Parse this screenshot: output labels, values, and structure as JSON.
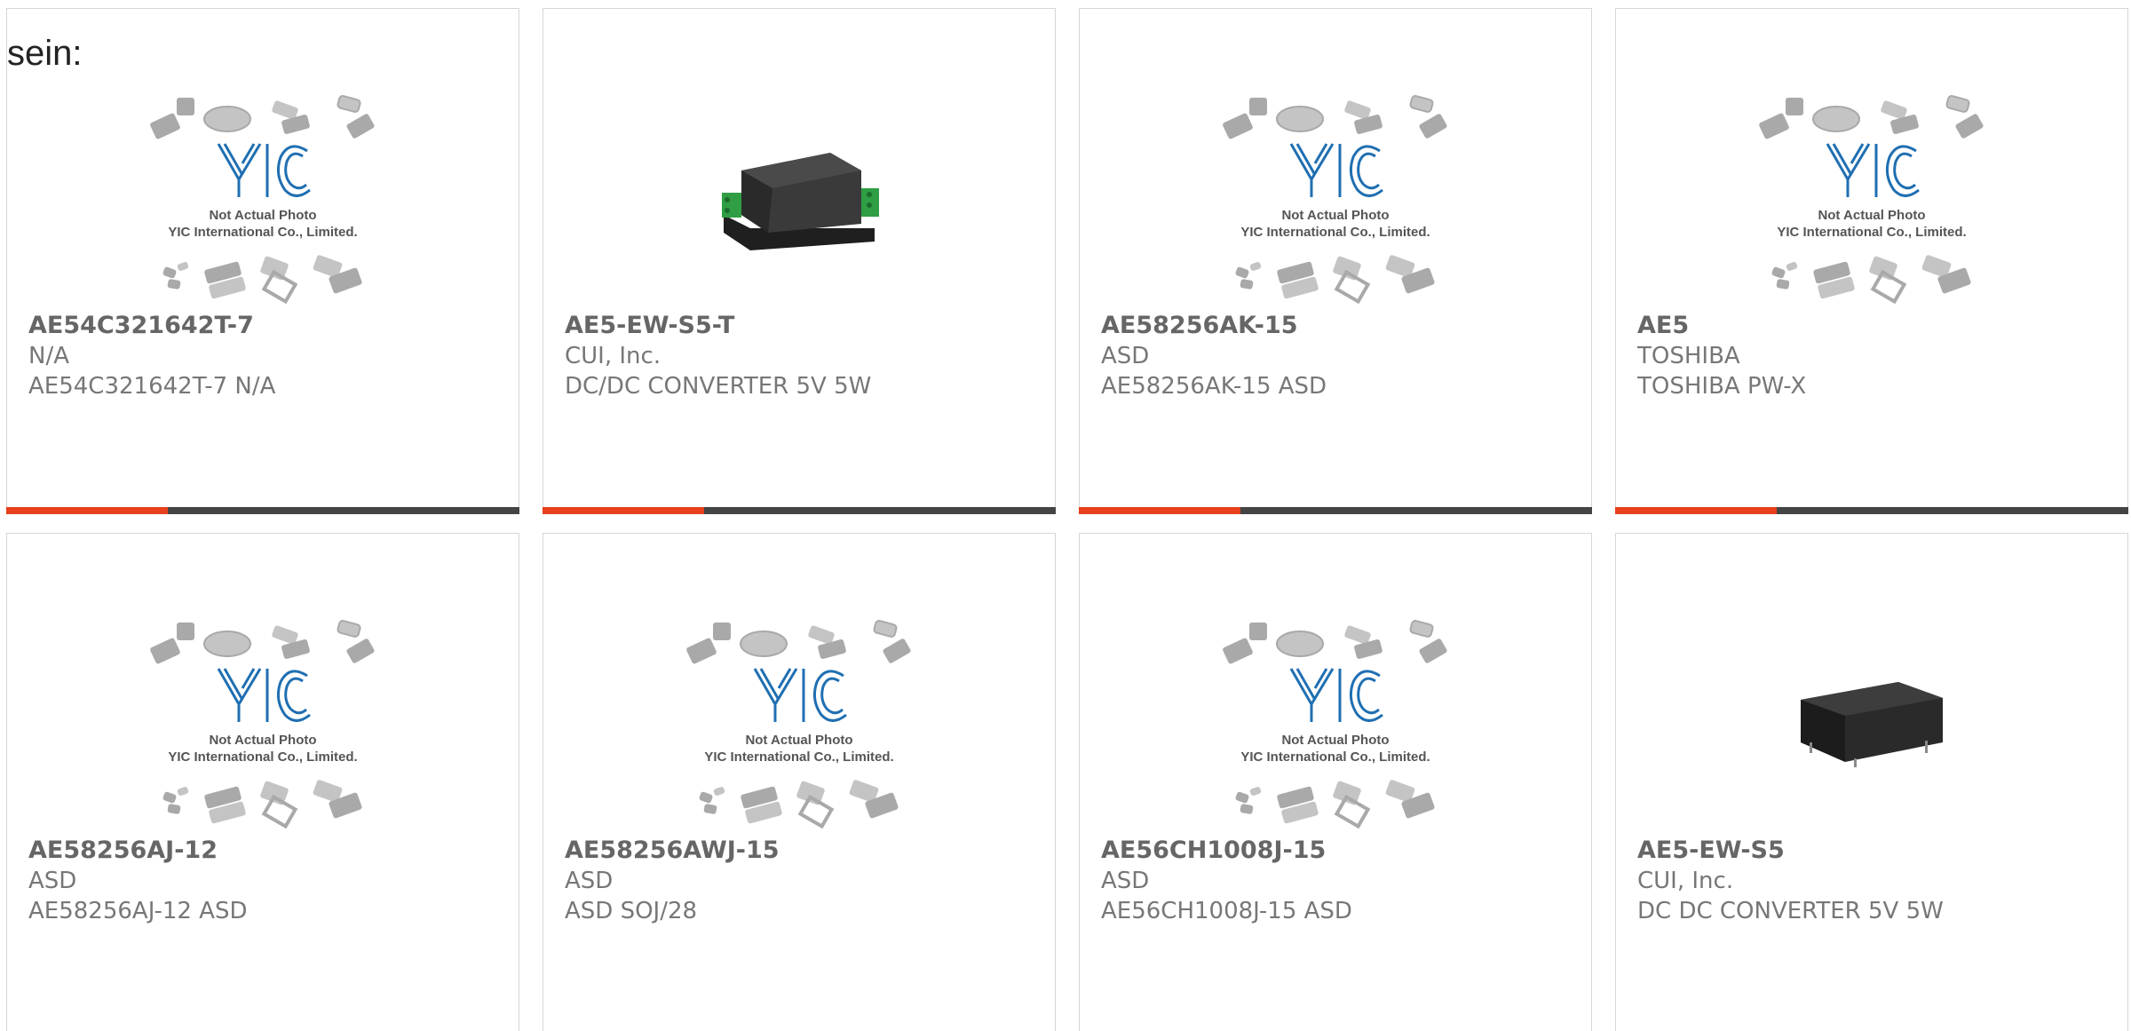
{
  "lead_text": "sein:",
  "colors": {
    "accent": "#e8401c",
    "bar_dark": "#444444",
    "logo_blue": "#1f6fb2"
  },
  "placeholder": {
    "line1": "Not Actual Photo",
    "line2": "YIC International Co., Limited."
  },
  "products": [
    {
      "part": "AE54C321642T-7",
      "manufacturer": "N/A",
      "description": "AE54C321642T-7 N/A",
      "image": "placeholder"
    },
    {
      "part": "AE5-EW-S5-T",
      "manufacturer": "CUI, Inc.",
      "description": "DC/DC CONVERTER 5V 5W",
      "image": "converter-with-terminals"
    },
    {
      "part": "AE58256AK-15",
      "manufacturer": "ASD",
      "description": "AE58256AK-15 ASD",
      "image": "placeholder"
    },
    {
      "part": "AE5",
      "manufacturer": "TOSHIBA",
      "description": "TOSHIBA PW-X",
      "image": "placeholder"
    },
    {
      "part": "AE58256AJ-12",
      "manufacturer": "ASD",
      "description": "AE58256AJ-12 ASD",
      "image": "placeholder"
    },
    {
      "part": "AE58256AWJ-15",
      "manufacturer": "ASD",
      "description": "ASD SOJ/28",
      "image": "placeholder"
    },
    {
      "part": "AE56CH1008J-15",
      "manufacturer": "ASD",
      "description": "AE56CH1008J-15 ASD",
      "image": "placeholder"
    },
    {
      "part": "AE5-EW-S5",
      "manufacturer": "CUI, Inc.",
      "description": "DC DC CONVERTER 5V 5W",
      "image": "converter-block"
    }
  ]
}
